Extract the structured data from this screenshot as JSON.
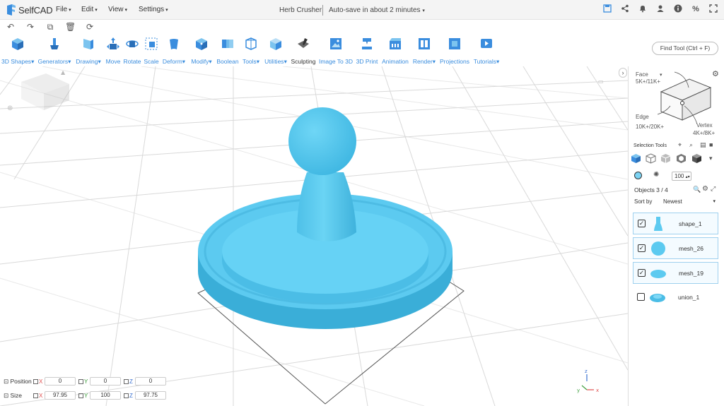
{
  "app": {
    "logo_text": "SelfCAD",
    "menus": [
      "File",
      "Edit",
      "View",
      "Settings"
    ],
    "document_title": "Herb Crusher",
    "autosave_text": "Auto-save in about 2 minutes",
    "top_icons": [
      "save-icon",
      "share-icon",
      "bell-icon",
      "user-icon",
      "info-icon",
      "percent-icon",
      "fullscreen-icon"
    ]
  },
  "history": [
    "undo-icon",
    "redo-icon",
    "copy-icon",
    "delete-icon",
    "refresh-icon"
  ],
  "toolbar": {
    "tools": [
      {
        "label": "3D Shapes",
        "dropdown": true
      },
      {
        "label": "Generators",
        "dropdown": true
      },
      {
        "label": "Drawing",
        "dropdown": true
      },
      {
        "label": "Move",
        "dropdown": false
      },
      {
        "label": "Rotate",
        "dropdown": false
      },
      {
        "label": "Scale",
        "dropdown": false
      },
      {
        "label": "Deform",
        "dropdown": true
      },
      {
        "label": "Modify",
        "dropdown": true
      },
      {
        "label": "Boolean",
        "dropdown": false
      },
      {
        "label": "Tools",
        "dropdown": true
      },
      {
        "label": "Utilities",
        "dropdown": true
      },
      {
        "label": "Sculpting",
        "dropdown": false
      },
      {
        "label": "Image To 3D",
        "dropdown": false
      },
      {
        "label": "3D Print",
        "dropdown": false
      },
      {
        "label": "Animation",
        "dropdown": false
      },
      {
        "label": "Render",
        "dropdown": true
      },
      {
        "label": "Projections",
        "dropdown": false
      },
      {
        "label": "Tutorials",
        "dropdown": true
      }
    ],
    "find_tool": "Find Tool (Ctrl + F)"
  },
  "transform": {
    "position_label": "Position",
    "size_label": "Size",
    "axes": [
      "X",
      "Y",
      "Z"
    ],
    "position": [
      "0",
      "0",
      "0"
    ],
    "size": [
      "97.95",
      "100",
      "97.75"
    ]
  },
  "panel": {
    "face_label": "Face",
    "face_count": "5K+/11K+",
    "edge_label": "Edge",
    "edge_count": "10K+/20K+",
    "vertex_label": "Vertex",
    "vertex_count": "4K+/8K+",
    "selection_tools_label": "Selection Tools",
    "brush_size": "100",
    "objects_label": "Objects 3 / 4",
    "sort_label": "Sort by",
    "sort_value": "Newest",
    "objects": [
      {
        "name": "shape_1",
        "checked": true,
        "selected": true
      },
      {
        "name": "mesh_26",
        "checked": true,
        "selected": true
      },
      {
        "name": "mesh_19",
        "checked": true,
        "selected": true
      },
      {
        "name": "union_1",
        "checked": false,
        "selected": false
      }
    ]
  },
  "colors": {
    "accent": "#3a8dde",
    "model": "#5ac8ec",
    "model_dark": "#3fb0da",
    "selection_border": "#9ed0ee"
  }
}
